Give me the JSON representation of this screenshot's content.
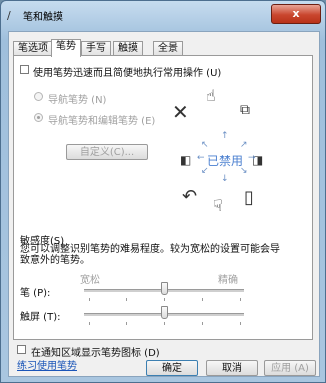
{
  "window": {
    "title": "笔和触摸",
    "close_label": "x"
  },
  "tabs": [
    {
      "label": "笔选项"
    },
    {
      "label": "笔势"
    },
    {
      "label": "手写"
    },
    {
      "label": "触摸"
    },
    {
      "label": "全景"
    }
  ],
  "active_tab": "笔势",
  "main": {
    "flicks_checkbox_label": "使用笔势迅速而且简便地执行常用操作 (U)",
    "flicks_checked": false,
    "radio_nav_label": "导航笔势 (N)",
    "radio_nav_edit_label": "导航笔势和编辑笔势 (E)",
    "radio_selected": "导航笔势和编辑笔势 (E)",
    "customize_button": "自定义(C)...",
    "disabled_text": "已禁用",
    "gesture_icons": [
      "delete-x-icon",
      "hand-up-icon",
      "copy-icon",
      "page-forward-icon",
      "paste-icon",
      "page-back-icon",
      "undo-icon",
      "hand-down-icon"
    ],
    "sensitivity_title": "敏感度(S)",
    "sensitivity_desc": "您可以调整识别笔势的难易程度。较为宽松的设置可能会导致意外的笔势。",
    "scale_relaxed": "宽松",
    "scale_precise": "精确",
    "pen_label": "笔 (P):",
    "touch_label": "触屏 (T):",
    "pen_sensitivity": 0.5,
    "touch_sensitivity": 0.5,
    "tray_icon_checkbox_label": "在通知区域显示笔势图标 (D)",
    "tray_icon_checked": false,
    "practice_link": "练习使用笔势"
  },
  "footer": {
    "ok": "确定",
    "cancel": "取消",
    "apply": "应用 (A)"
  },
  "colors": {
    "link": "#1a55b8",
    "disabled_blue": "#4a7fd0",
    "close_red": "#c9462e"
  }
}
